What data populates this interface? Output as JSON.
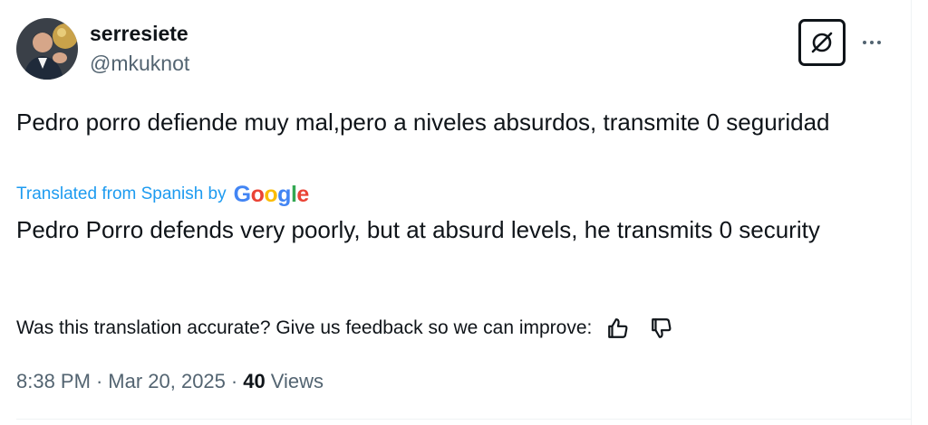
{
  "author": {
    "display_name": "serresiete",
    "handle": "@mkuknot",
    "avatar_icon": "profile-photo"
  },
  "tweet": {
    "text": "Pedro porro defiende muy mal,pero a niveles absurdos, transmite 0 seguridad"
  },
  "translation": {
    "label": "Translated from Spanish by",
    "provider": "Google",
    "text": "Pedro Porro defends very poorly, but at absurd levels, he transmits 0 security",
    "link_color": "#1d9bf0"
  },
  "feedback": {
    "prompt": "Was this translation accurate? Give us feedback so we can improve:",
    "thumbs_up_icon": "thumbs-up-icon",
    "thumbs_down_icon": "thumbs-down-icon"
  },
  "meta": {
    "time": "8:38 PM",
    "separator": "·",
    "date": "Mar 20, 2025",
    "views_count": "40",
    "views_label": "Views"
  },
  "header_actions": {
    "grok_icon": "grok-icon",
    "more_icon": "more-horizontal-icon"
  },
  "colors": {
    "text_primary": "#0f1419",
    "text_secondary": "#536471",
    "accent": "#1d9bf0",
    "google_blue": "#4285F4",
    "google_red": "#EA4335",
    "google_yellow": "#FBBC05",
    "google_green": "#34A853"
  }
}
